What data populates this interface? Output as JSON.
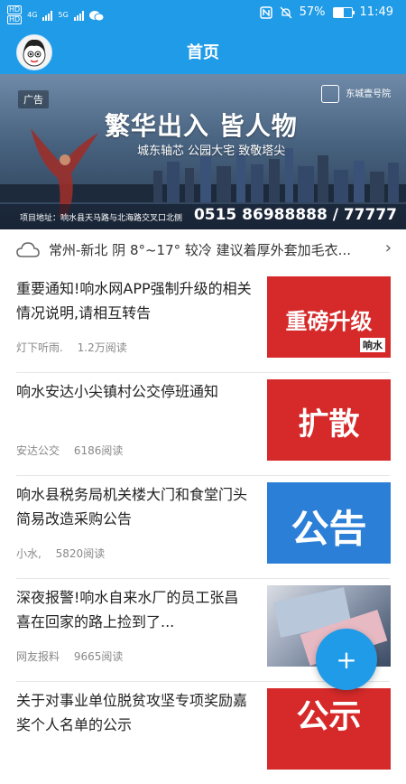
{
  "status_bar": {
    "hd_top": "HD",
    "hd_bottom": "HD",
    "network_1": "4G",
    "network_2": "5G",
    "battery": "57%",
    "time": "11:49",
    "battery_level": 0.57
  },
  "header": {
    "title": "首页"
  },
  "ad": {
    "label": "广告",
    "headline": "繁华出入 皆人物",
    "subline": "城东轴芯 公园大宅 致敬塔尖",
    "brand": "东城壹号院",
    "address": "项目地址：响水县天马路与北海路交叉口北侧",
    "phone": "0515 86988888 / 77777"
  },
  "weather": {
    "text": "常州-新北 阴 8°~17° 较冷 建议着厚外套加毛衣..."
  },
  "news": [
    {
      "title": "重要通知!响水网APP强制升级的相关情况说明,请相互转告",
      "source": "灯下听雨.",
      "reads": "1.2万阅读",
      "thumb_text": "重磅升级",
      "thumb_sub": "响水"
    },
    {
      "title": "响水安达小尖镇村公交停班通知",
      "source": "安达公交",
      "reads": "6186阅读",
      "thumb_text": "扩散"
    },
    {
      "title": "响水县税务局机关楼大门和食堂门头简易改造采购公告",
      "source": "小水,",
      "reads": "5820阅读",
      "thumb_text": "公告"
    },
    {
      "title": "深夜报警!响水自来水厂的员工张昌喜在回家的路上捡到了...",
      "source": "网友报料",
      "reads": "9665阅读"
    },
    {
      "title": "关于对事业单位脱贫攻坚专项奖励嘉奖个人名单的公示",
      "thumb_text": "公示"
    }
  ],
  "fab": {
    "label": "+"
  },
  "colors": {
    "primary": "#1f9be8",
    "accent_red": "#d62a2a",
    "accent_blue": "#2c7fd6"
  }
}
